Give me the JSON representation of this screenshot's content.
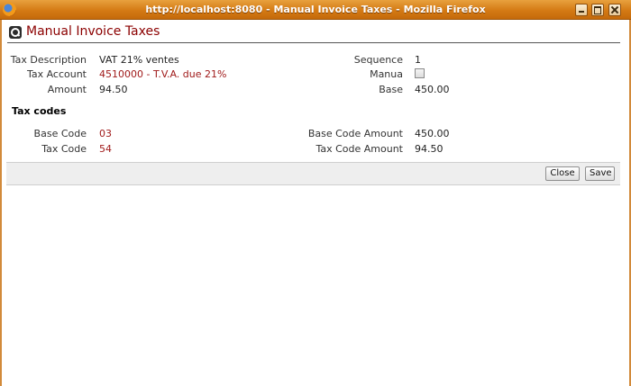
{
  "window": {
    "title": "http://localhost:8080 - Manual Invoice Taxes - Mozilla Firefox"
  },
  "page": {
    "title": "Manual Invoice Taxes"
  },
  "form": {
    "tax_description_label": "Tax Description",
    "tax_description_value": "VAT 21% ventes",
    "tax_account_label": "Tax Account",
    "tax_account_value": "4510000 - T.V.A. due 21%",
    "amount_label": "Amount",
    "amount_value": "94.50",
    "sequence_label": "Sequence",
    "sequence_value": "1",
    "manual_label": "Manua",
    "manual_checked": false,
    "base_label": "Base",
    "base_value": "450.00"
  },
  "tax_codes": {
    "section_title": "Tax codes",
    "base_code_label": "Base Code",
    "base_code_value": "03",
    "tax_code_label": "Tax Code",
    "tax_code_value": "54",
    "base_code_amount_label": "Base Code Amount",
    "base_code_amount_value": "450.00",
    "tax_code_amount_label": "Tax Code Amount",
    "tax_code_amount_value": "94.50"
  },
  "toolbar": {
    "close_label": "Close",
    "save_label": "Save"
  }
}
